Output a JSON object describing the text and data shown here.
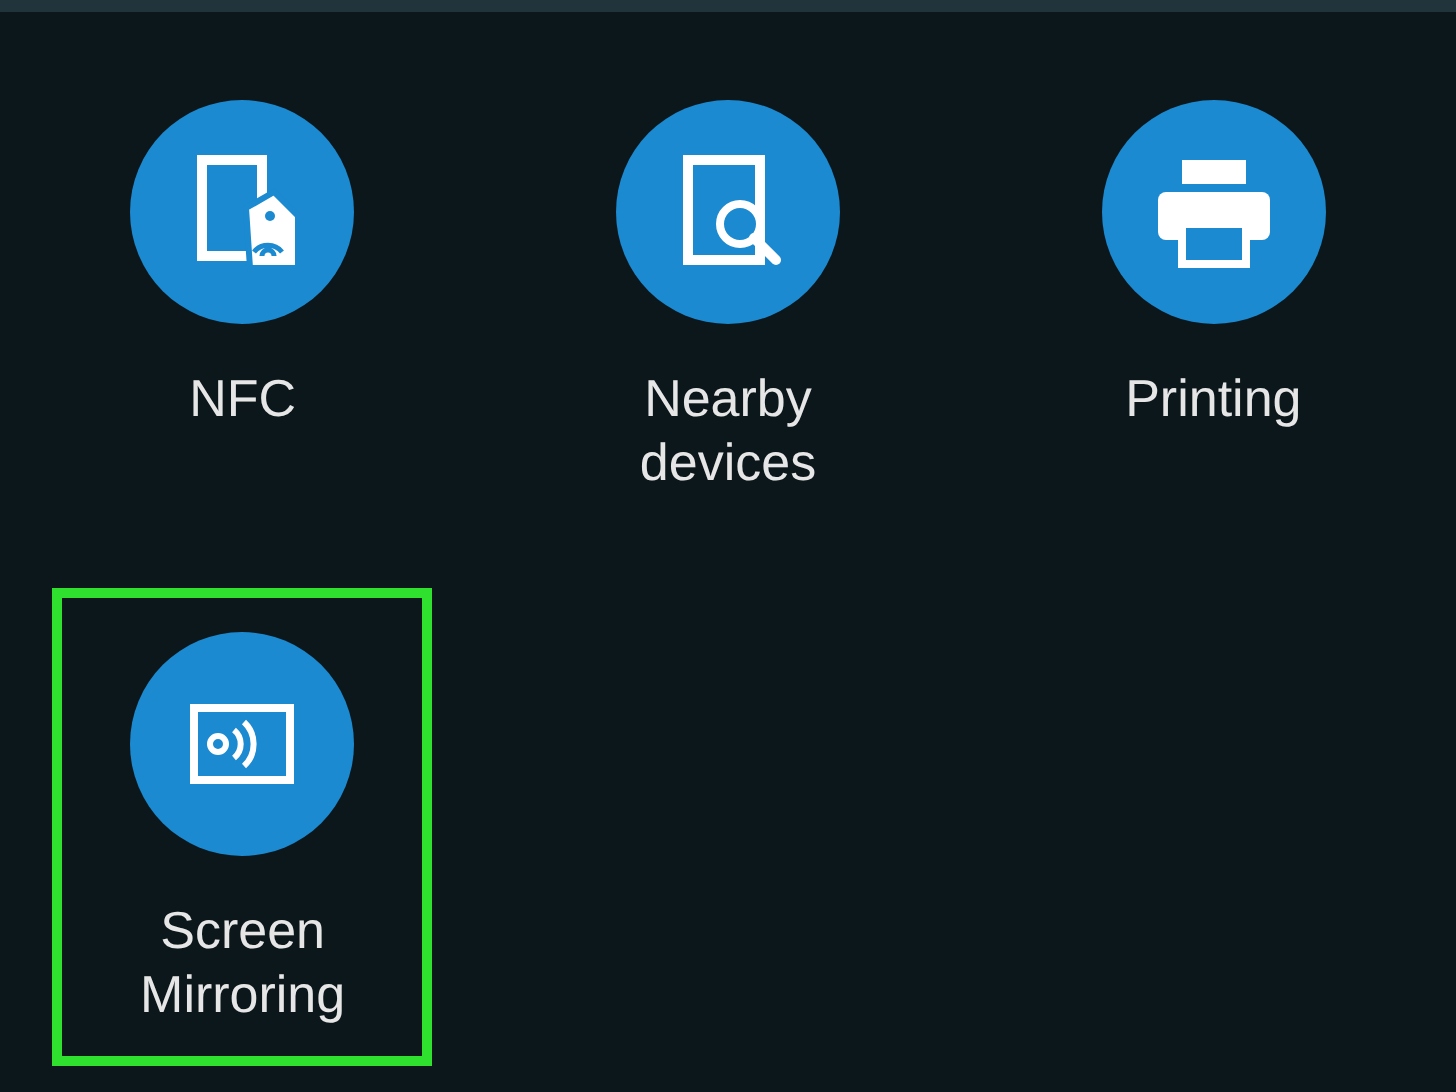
{
  "tiles": [
    {
      "label": "NFC",
      "kind": "nfc",
      "highlighted": false
    },
    {
      "label": "Nearby devices",
      "kind": "nearby",
      "highlighted": false
    },
    {
      "label": "Printing",
      "kind": "printing",
      "highlighted": false
    },
    {
      "label": "Screen Mirroring",
      "kind": "mirroring",
      "highlighted": true
    }
  ]
}
